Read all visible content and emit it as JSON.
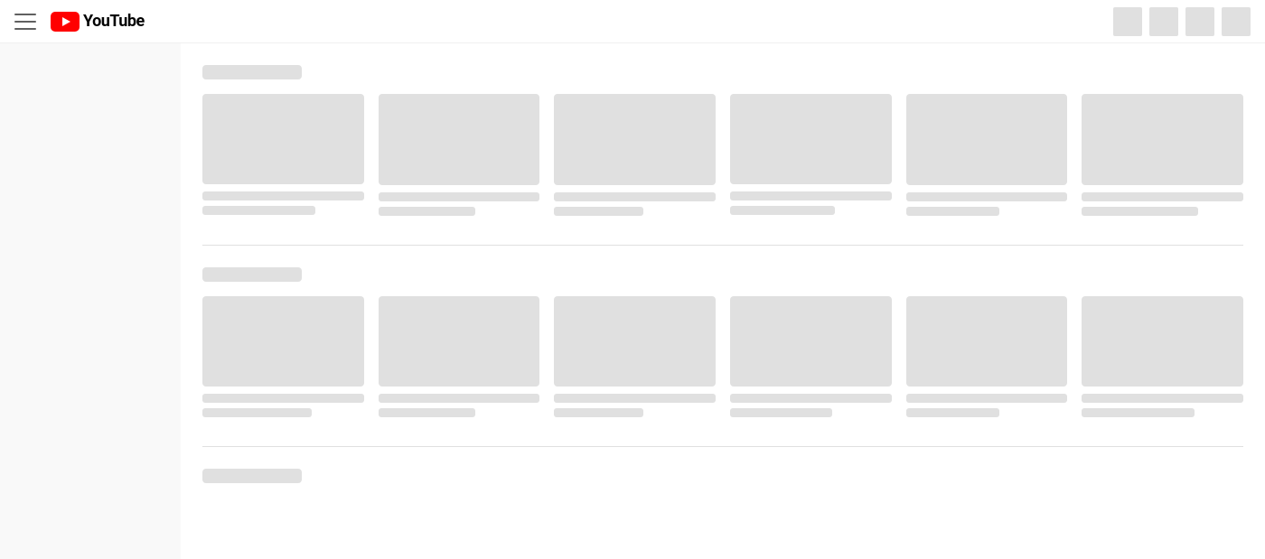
{
  "header": {
    "title": "YouTube",
    "logo_text": "YouTube"
  },
  "sidebar": {
    "background": "#f9f9f9"
  },
  "sections": [
    {
      "id": "section-1",
      "cards": [
        {
          "title_width": "100%",
          "meta_width": "70%"
        },
        {
          "title_width": "100%",
          "meta_width": "60%"
        },
        {
          "title_width": "100%",
          "meta_width": "55%"
        },
        {
          "title_width": "100%",
          "meta_width": "65%"
        },
        {
          "title_width": "100%",
          "meta_width": "58%"
        },
        {
          "title_width": "100%",
          "meta_width": "72%"
        }
      ]
    },
    {
      "id": "section-2",
      "cards": [
        {
          "title_width": "100%",
          "meta_width": "68%"
        },
        {
          "title_width": "100%",
          "meta_width": "60%"
        },
        {
          "title_width": "100%",
          "meta_width": "55%"
        },
        {
          "title_width": "100%",
          "meta_width": "63%"
        },
        {
          "title_width": "100%",
          "meta_width": "58%"
        },
        {
          "title_width": "100%",
          "meta_width": "70%"
        }
      ]
    },
    {
      "id": "section-3",
      "cards": []
    }
  ],
  "avatars": [
    "avatar-1",
    "avatar-2",
    "avatar-3",
    "avatar-4"
  ]
}
